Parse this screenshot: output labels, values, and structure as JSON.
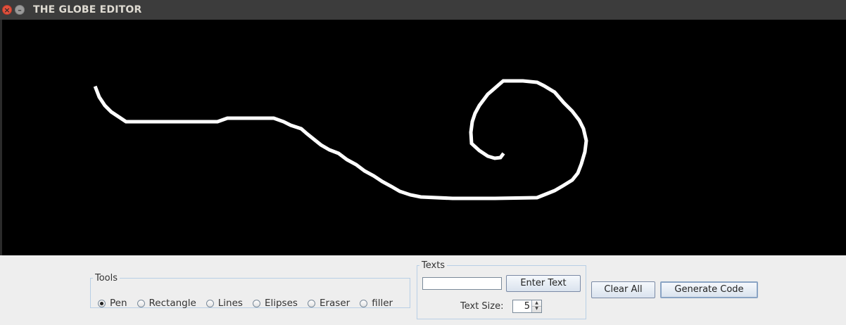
{
  "window": {
    "title": "THE GLOBE EDITOR",
    "close_glyph": "×",
    "minimize_glyph": "–"
  },
  "canvas": {
    "background": "#000000",
    "stroke_color": "#ffffff"
  },
  "tools": {
    "legend": "Tools",
    "options": [
      "Pen",
      "Rectangle",
      "Lines",
      "Elipses",
      "Eraser",
      "filler"
    ],
    "selected": "Pen"
  },
  "texts": {
    "legend": "Texts",
    "input_value": "",
    "enter_button": "Enter Text",
    "size_label": "Text Size:",
    "size_value": "5"
  },
  "actions": {
    "clear_all": "Clear All",
    "generate_code": "Generate Code"
  },
  "colors": {
    "titlebar": "#3c3c3c",
    "panel": "#eeeeee",
    "close_button": "#e2513d",
    "fieldset_border": "#b8cfe5"
  }
}
